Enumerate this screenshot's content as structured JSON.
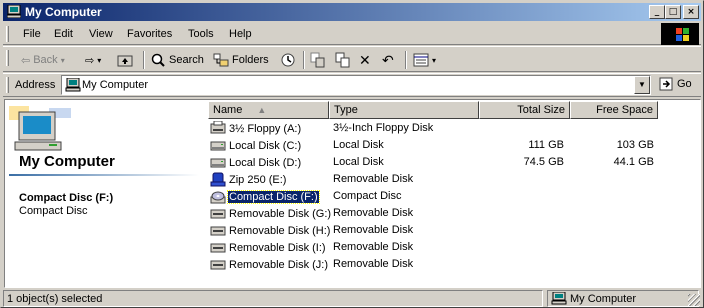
{
  "window": {
    "title": "My Computer",
    "minimize_label": "_",
    "maximize_label": "□",
    "close_label": "×"
  },
  "menu": [
    "File",
    "Edit",
    "View",
    "Favorites",
    "Tools",
    "Help"
  ],
  "toolbar": {
    "back_label": "Back",
    "search_label": "Search",
    "folders_label": "Folders"
  },
  "address": {
    "label": "Address",
    "value": "My Computer",
    "go_label": "Go"
  },
  "webview": {
    "title": "My Computer",
    "selected_name": "Compact Disc (F:)",
    "selected_type": "Compact Disc"
  },
  "columns": {
    "name": "Name",
    "type": "Type",
    "total_size": "Total Size",
    "free_space": "Free Space"
  },
  "items": [
    {
      "name": "3½ Floppy (A:)",
      "type": "3½-Inch Floppy Disk",
      "total": "",
      "free": "",
      "icon": "floppy-drive-icon"
    },
    {
      "name": "Local Disk (C:)",
      "type": "Local Disk",
      "total": "111 GB",
      "free": "103 GB",
      "icon": "hard-drive-icon"
    },
    {
      "name": "Local Disk (D:)",
      "type": "Local Disk",
      "total": "74.5 GB",
      "free": "44.1 GB",
      "icon": "hard-drive-icon"
    },
    {
      "name": "Zip 250 (E:)",
      "type": "Removable Disk",
      "total": "",
      "free": "",
      "icon": "zip-drive-icon"
    },
    {
      "name": "Compact Disc (F:)",
      "type": "Compact Disc",
      "total": "",
      "free": "",
      "icon": "cd-drive-icon",
      "selected": true
    },
    {
      "name": "Removable Disk (G:)",
      "type": "Removable Disk",
      "total": "",
      "free": "",
      "icon": "removable-drive-icon"
    },
    {
      "name": "Removable Disk (H:)",
      "type": "Removable Disk",
      "total": "",
      "free": "",
      "icon": "removable-drive-icon"
    },
    {
      "name": "Removable Disk (I:)",
      "type": "Removable Disk",
      "total": "",
      "free": "",
      "icon": "removable-drive-icon"
    },
    {
      "name": "Removable Disk (J:)",
      "type": "Removable Disk",
      "total": "",
      "free": "",
      "icon": "removable-drive-icon"
    }
  ],
  "status": {
    "left": "1 object(s) selected",
    "right": "My Computer"
  },
  "colors": {
    "titlebar_start": "#0a246a",
    "titlebar_end": "#a6caf0",
    "selection": "#0a246a",
    "face": "#d4d0c8"
  }
}
